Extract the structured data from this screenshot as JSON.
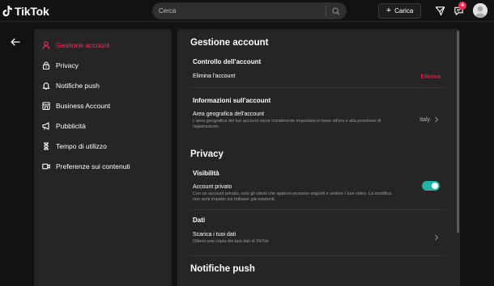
{
  "brand": {
    "name": "TikTok"
  },
  "search": {
    "placeholder": "Cerca"
  },
  "header": {
    "upload_label": "Carica",
    "notification_count": "4"
  },
  "sidebar": {
    "items": [
      {
        "label": "Gestione account",
        "icon": "person-icon",
        "active": true
      },
      {
        "label": "Privacy",
        "icon": "lock-icon"
      },
      {
        "label": "Notifiche push",
        "icon": "bell-icon"
      },
      {
        "label": "Business Account",
        "icon": "shop-icon"
      },
      {
        "label": "Pubblicità",
        "icon": "megaphone-icon"
      },
      {
        "label": "Tempo di utilizzo",
        "icon": "hourglass-icon"
      },
      {
        "label": "Preferenze sui contenuti",
        "icon": "video-icon"
      }
    ]
  },
  "main": {
    "account": {
      "title": "Gestione account",
      "control_title": "Controllo dell'account",
      "delete_row_label": "Elimina l'account",
      "delete_action": "Elimina",
      "info_title": "Informazioni sull'account",
      "region_label": "Area geografica dell'account",
      "region_desc": "L'area geografica del tuo account viene inizialmente impostata in base all'ora e alla posizione di registrazione.",
      "region_value": "Italy"
    },
    "privacy": {
      "title": "Privacy",
      "visibility_title": "Visibilità",
      "private_label": "Account privato",
      "private_desc": "Con un account privato, solo gli utenti che approvi possono seguirti e vedere i tuoi video. La modifica non avrà impatto sui follower già esistenti.",
      "private_enabled": true,
      "data_title": "Dati",
      "download_label": "Scarica i tuoi dati",
      "download_desc": "Ottieni una copia dei tuoi dati di TikTok"
    },
    "push": {
      "title": "Notifiche push"
    }
  },
  "colors": {
    "accent": "#fe2c55",
    "toggle_on": "#20b2a2",
    "panel": "#252525",
    "background": "#121212"
  }
}
